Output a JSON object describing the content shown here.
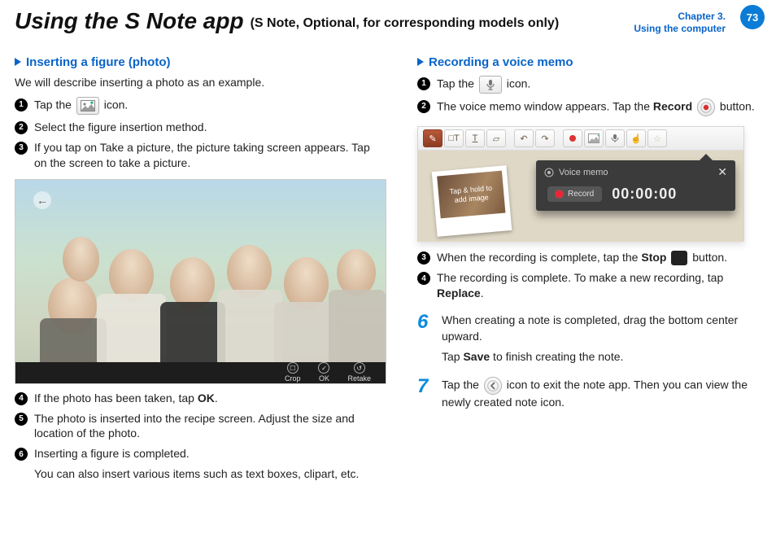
{
  "header": {
    "title": "Using the S Note app",
    "subtitle": "(S Note, Optional, for corresponding models only)",
    "chapter_line1": "Chapter 3.",
    "chapter_line2": "Using the computer",
    "page_number": "73"
  },
  "left": {
    "subhead": "Inserting a figure (photo)",
    "lead": "We will describe inserting a photo as an example.",
    "step1_a": "Tap the ",
    "step1_b": " icon.",
    "step2": "Select the figure insertion method.",
    "step3": "If you tap on Take a picture, the picture taking screen appears. Tap on the screen to take a picture.",
    "photobar": {
      "crop": "Crop",
      "ok": "OK",
      "retake": "Retake"
    },
    "step4_a": "If the photo has been taken, tap ",
    "step4_b": "OK",
    "step4_c": ".",
    "step5": "The photo is inserted into the recipe screen. Adjust the size and location of the photo.",
    "step6": "Inserting a figure is completed.",
    "note": "You can also insert various items such as text boxes, clipart, etc."
  },
  "right": {
    "subhead": "Recording a voice memo",
    "step1_a": "Tap the ",
    "step1_b": " icon.",
    "step2_a": "The voice memo window appears. Tap the ",
    "step2_b": "Record",
    "step2_c": " button.",
    "vm": {
      "polaroid_text": "Tap & hold to\nadd image",
      "popup_title": "Voice memo",
      "record_label": "Record",
      "time": "00:00:00"
    },
    "step3_a": "When the recording is complete, tap the ",
    "step3_b": "Stop",
    "step3_c": " button.",
    "step4_a": "The recording is complete. To make a new recording, tap ",
    "step4_b": "Replace",
    "step4_c": ".",
    "big6_a": "When creating a note is completed, drag the bottom center upward.",
    "big6_b_a": "Tap ",
    "big6_b_b": "Save",
    "big6_b_c": " to finish creating the note.",
    "big7_a": "Tap the ",
    "big7_b": " icon to exit the note app. Then you can view the newly created note icon."
  }
}
